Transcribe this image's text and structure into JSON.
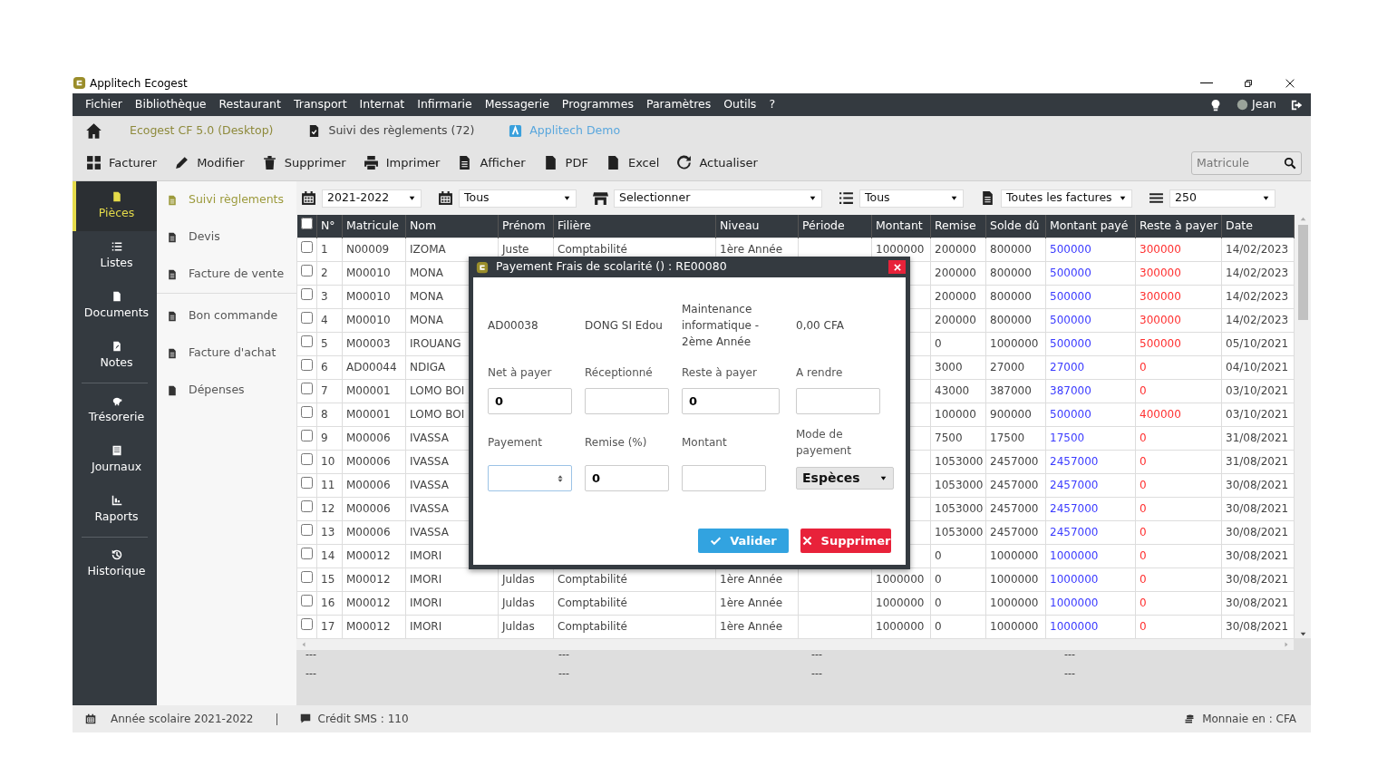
{
  "window": {
    "title": "Applitech Ecogest"
  },
  "menu": [
    "Fichier",
    "Bibliothèque",
    "Restaurant",
    "Transport",
    "Internat",
    "Infirmarie",
    "Messagerie",
    "Programmes",
    "Paramètres",
    "Outils",
    "?"
  ],
  "user": {
    "name": "Jean"
  },
  "tabs": [
    {
      "label": "Ecogest CF 5.0 (Desktop)",
      "kind": "home"
    },
    {
      "label": "Suivi des règlements (72)",
      "kind": "doc"
    },
    {
      "label": "Applitech Demo",
      "kind": "brand"
    }
  ],
  "toolbar": [
    "Facturer",
    "Modifier",
    "Supprimer",
    "Imprimer",
    "Afficher",
    "PDF",
    "Excel",
    "Actualiser"
  ],
  "search": {
    "placeholder": "Matricule"
  },
  "sidebar": [
    [
      {
        "label": "Pièces",
        "selected": true
      },
      {
        "label": "Listes",
        "selected": false
      },
      {
        "label": "Documents",
        "selected": false
      },
      {
        "label": "Notes",
        "selected": false
      }
    ],
    [
      {
        "label": "Trésorerie",
        "selected": false
      },
      {
        "label": "Journaux",
        "selected": false
      },
      {
        "label": "Raports",
        "selected": false
      }
    ],
    [
      {
        "label": "Historique",
        "selected": false
      }
    ]
  ],
  "subnav": [
    [
      {
        "label": "Suivi règlements",
        "selected": true
      },
      {
        "label": "Devis",
        "selected": false
      },
      {
        "label": "Facture de vente",
        "selected": false
      }
    ],
    [
      {
        "label": "Bon commande",
        "selected": false
      },
      {
        "label": "Facture d'achat",
        "selected": false
      },
      {
        "label": "Dépenses",
        "selected": false
      }
    ]
  ],
  "filters": [
    {
      "value": "2021-2022"
    },
    {
      "value": "Tous"
    },
    {
      "value": "Selectionner"
    },
    {
      "value": "Tous"
    },
    {
      "value": "Toutes les factures"
    },
    {
      "value": "250"
    }
  ],
  "table": {
    "header_checked": false,
    "columns": [
      "N°",
      "Matricule",
      "Nom",
      "Prénom",
      "Filière",
      "Niveau",
      "Période",
      "Montant",
      "Remise",
      "Solde dû",
      "Montant payé",
      "Reste à payer",
      "Date"
    ],
    "rows": [
      {
        "checked": false,
        "no": "1",
        "matricule": "N00009",
        "nom": "IZOMA",
        "prenom": "Juste",
        "filiere": "Comptabilité",
        "niveau": "1ère Année",
        "montant": "1000000",
        "remise": "200000",
        "solde": "800000",
        "paye": "500000",
        "reste": "300000",
        "date": "14/02/2023"
      },
      {
        "checked": false,
        "no": "2",
        "matricule": "M00010",
        "nom": "MONA",
        "remise": "200000",
        "solde": "800000",
        "paye": "500000",
        "reste": "300000",
        "date": "14/02/2023"
      },
      {
        "checked": false,
        "no": "3",
        "matricule": "M00010",
        "nom": "MONA",
        "remise": "200000",
        "solde": "800000",
        "paye": "500000",
        "reste": "300000",
        "date": "14/02/2023"
      },
      {
        "checked": false,
        "no": "4",
        "matricule": "M00010",
        "nom": "MONA",
        "remise": "200000",
        "solde": "800000",
        "paye": "500000",
        "reste": "300000",
        "date": "14/02/2023"
      },
      {
        "checked": false,
        "no": "5",
        "matricule": "M00003",
        "nom": "IROUANG",
        "remise": "0",
        "solde": "1000000",
        "paye": "500000",
        "reste": "500000",
        "date": "05/10/2021"
      },
      {
        "checked": false,
        "no": "6",
        "matricule": "AD00044",
        "nom": "NDIGA",
        "remise": "3000",
        "solde": "27000",
        "paye": "27000",
        "reste": "0",
        "date": "04/10/2021"
      },
      {
        "checked": false,
        "no": "7",
        "matricule": "M00001",
        "nom": "LOMO BOI",
        "remise": "43000",
        "solde": "387000",
        "paye": "387000",
        "reste": "0",
        "date": "03/10/2021"
      },
      {
        "checked": false,
        "no": "8",
        "matricule": "M00001",
        "nom": "LOMO BOI",
        "remise": "100000",
        "solde": "900000",
        "paye": "500000",
        "reste": "400000",
        "date": "03/10/2021"
      },
      {
        "checked": false,
        "no": "9",
        "matricule": "M00006",
        "nom": "IVASSA",
        "remise": "7500",
        "solde": "17500",
        "paye": "17500",
        "reste": "0",
        "date": "31/08/2021"
      },
      {
        "checked": false,
        "no": "10",
        "matricule": "M00006",
        "nom": "IVASSA",
        "remise": "1053000",
        "solde": "2457000",
        "paye": "2457000",
        "reste": "0",
        "date": "31/08/2021"
      },
      {
        "checked": false,
        "no": "11",
        "matricule": "M00006",
        "nom": "IVASSA",
        "remise": "1053000",
        "solde": "2457000",
        "paye": "2457000",
        "reste": "0",
        "date": "30/08/2021"
      },
      {
        "checked": false,
        "no": "12",
        "matricule": "M00006",
        "nom": "IVASSA",
        "remise": "1053000",
        "solde": "2457000",
        "paye": "2457000",
        "reste": "0",
        "date": "30/08/2021"
      },
      {
        "checked": false,
        "no": "13",
        "matricule": "M00006",
        "nom": "IVASSA",
        "remise": "1053000",
        "solde": "2457000",
        "paye": "2457000",
        "reste": "0",
        "date": "30/08/2021"
      },
      {
        "checked": false,
        "no": "14",
        "matricule": "M00012",
        "nom": "IMORI",
        "remise": "0",
        "solde": "1000000",
        "paye": "1000000",
        "reste": "0",
        "date": "30/08/2021"
      },
      {
        "checked": false,
        "no": "15",
        "matricule": "M00012",
        "nom": "IMORI",
        "prenom": "Juldas",
        "filiere": "Comptabilité",
        "niveau": "1ère Année",
        "montant": "1000000",
        "remise": "0",
        "solde": "1000000",
        "paye": "1000000",
        "reste": "0",
        "date": "30/08/2021"
      },
      {
        "checked": false,
        "no": "16",
        "matricule": "M00012",
        "nom": "IMORI",
        "prenom": "Juldas",
        "filiere": "Comptabilité",
        "niveau": "1ère Année",
        "montant": "1000000",
        "remise": "0",
        "solde": "1000000",
        "paye": "1000000",
        "reste": "0",
        "date": "30/08/2021"
      },
      {
        "checked": false,
        "no": "17",
        "matricule": "M00012",
        "nom": "IMORI",
        "prenom": "Juldas",
        "filiere": "Comptabilité",
        "niveau": "1ère Année",
        "montant": "1000000",
        "remise": "0",
        "solde": "1000000",
        "paye": "1000000",
        "reste": "0",
        "date": "30/08/2021"
      }
    ]
  },
  "summary": [
    [
      "---",
      "---",
      "---",
      "---"
    ],
    [
      "---",
      "---",
      "---",
      "---"
    ]
  ],
  "status_bar": {
    "year": "Année scolaire 2021-2022",
    "sms": "Crédit SMS : 110",
    "currency": "Monnaie en : CFA"
  },
  "dialog": {
    "title": "Payement Frais de scolarité () : RE00080",
    "info": [
      "AD00038",
      "DONG SI Edou",
      "Maintenance informatique - 2ème Année",
      "0,00 CFA"
    ],
    "fields": [
      {
        "label": "Net à payer",
        "value": "0",
        "kind": "text"
      },
      {
        "label": "Réceptionné",
        "kind": "text"
      },
      {
        "label": "Reste à payer",
        "value": "0",
        "kind": "text"
      },
      {
        "label": "A rendre",
        "kind": "text"
      },
      {
        "label": "Payement",
        "kind": "number"
      },
      {
        "label": "Remise (%)",
        "value": "0",
        "kind": "text"
      },
      {
        "label": "Montant",
        "kind": "text"
      },
      {
        "label": "Mode de payement",
        "value": "Espèces",
        "kind": "select"
      }
    ],
    "buttons": [
      {
        "label": "Valider",
        "kind": "primary"
      },
      {
        "label": "Supprimer",
        "kind": "danger"
      }
    ]
  }
}
